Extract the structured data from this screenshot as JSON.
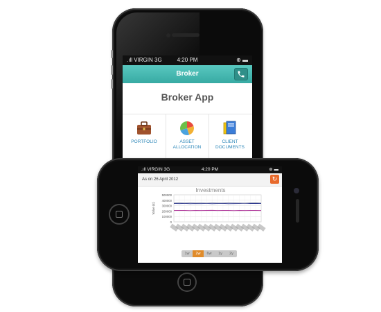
{
  "portrait": {
    "status": {
      "carrier": ".ıll VIRGIN  3G",
      "time": "4:20 PM",
      "battery": "⊕ ▬"
    },
    "nav_title": "Broker",
    "app_title": "Broker App",
    "tiles": [
      {
        "label": "PORTFOLIO",
        "icon": "briefcase-icon"
      },
      {
        "label": "ASSET ALLOCATION",
        "icon": "pie-chart-icon"
      },
      {
        "label": "CLIENT DOCUMENTS",
        "icon": "documents-icon"
      }
    ]
  },
  "landscape": {
    "status": {
      "carrier": ".ıll VIRGIN  3G",
      "time": "4:20 PM",
      "battery": "⊕ ▬"
    },
    "as_on": "As on 26 April 2012",
    "range_tabs": [
      "1w",
      "2w",
      "6w",
      "1y",
      "2y"
    ],
    "active_tab_index": 1
  },
  "chart_data": {
    "type": "line",
    "title": "Investments",
    "xlabel": "",
    "ylabel": "Value (£)",
    "ylim": [
      0,
      500000
    ],
    "yticks": [
      0,
      100000,
      200000,
      300000,
      400000,
      500000
    ],
    "categories": [
      "1",
      "2",
      "3",
      "4",
      "5",
      "6",
      "7",
      "8",
      "9",
      "10",
      "11",
      "12",
      "13",
      "14",
      "15",
      "16",
      "17"
    ],
    "series": [
      {
        "values": [
          340000,
          338000,
          342000,
          336000,
          340000,
          338000,
          341000,
          337000,
          339000,
          342000,
          336000,
          338000,
          340000,
          343000,
          339000,
          341000,
          340000
        ],
        "color": "#2f3a8f"
      },
      {
        "values": [
          350000,
          352000,
          349000,
          353000,
          350000,
          351000,
          348000,
          352000,
          350000,
          349000,
          353000,
          351000,
          350000,
          348000,
          352000,
          354000,
          350000
        ],
        "color": "#9aa0b8"
      },
      {
        "values": [
          210000,
          212000,
          211000,
          209000,
          212000,
          210000,
          211000,
          213000,
          210000,
          212000,
          211000,
          209000,
          212000,
          210000,
          211000,
          212000,
          210000
        ],
        "color": "#b0389b"
      }
    ],
    "grid": true
  },
  "colors": {
    "teal": "#3fb4ad",
    "orange": "#e86a2c",
    "link": "#2b86b8"
  }
}
